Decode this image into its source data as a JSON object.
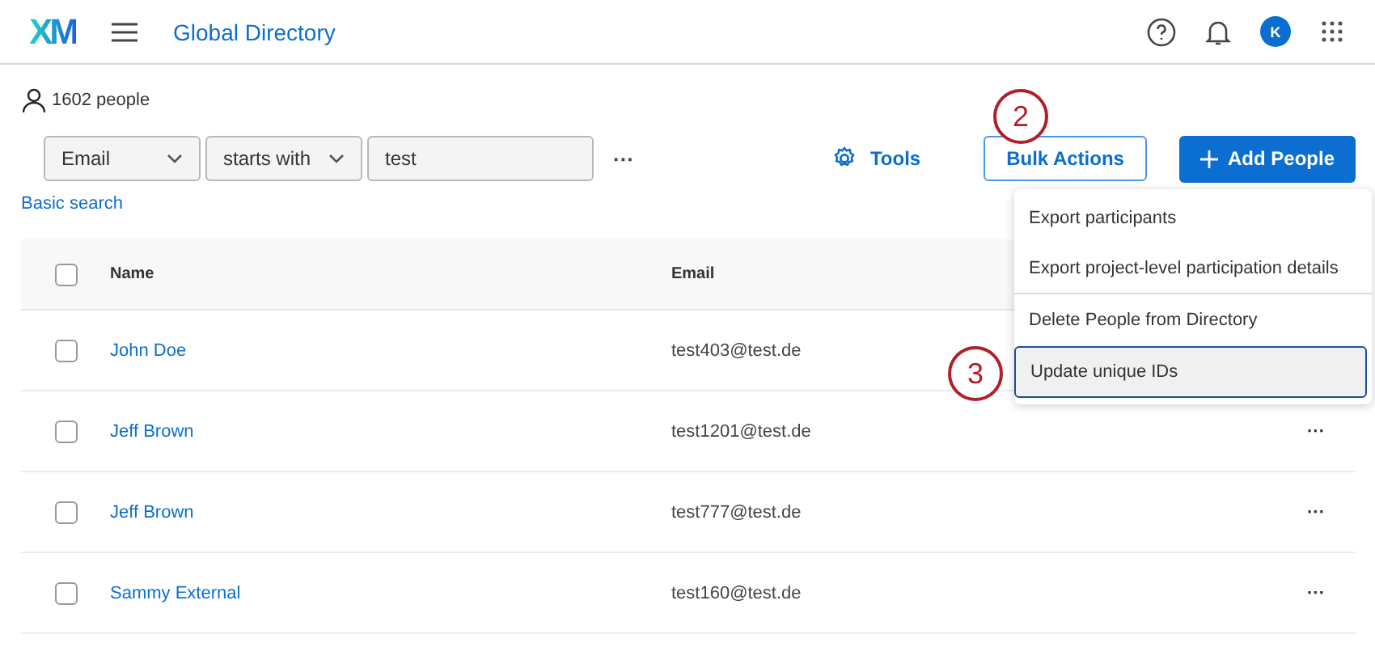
{
  "header": {
    "logo": "XM",
    "title": "Global Directory",
    "avatar": "K"
  },
  "count": "1602 people",
  "filter": {
    "field": "Email",
    "operator": "starts with",
    "value": "test",
    "more": "···"
  },
  "basic_search": "Basic search",
  "tools": "Tools",
  "bulk_actions": "Bulk Actions",
  "add_people": "Add People",
  "bulk_callout": "2",
  "menu_callout": "3",
  "menu": [
    {
      "label": "Export participants",
      "selected": false,
      "divider_after": false
    },
    {
      "label": "Export project-level participation details",
      "selected": false,
      "divider_after": true
    },
    {
      "label": "Delete People from Directory",
      "selected": false,
      "divider_after": false
    },
    {
      "label": "Update unique IDs",
      "selected": true,
      "divider_after": false
    }
  ],
  "table": {
    "columns": [
      "Name",
      "Email"
    ],
    "select_all_checked": false,
    "rows": [
      {
        "name": "John Doe",
        "email": "test403@test.de",
        "checked": false
      },
      {
        "name": "Jeff Brown",
        "email": "test1201@test.de",
        "checked": false,
        "actions": "···"
      },
      {
        "name": "Jeff Brown",
        "email": "test777@test.de",
        "checked": false,
        "actions": "···"
      },
      {
        "name": "Sammy External",
        "email": "test160@test.de",
        "checked": false,
        "actions": "···"
      }
    ]
  }
}
